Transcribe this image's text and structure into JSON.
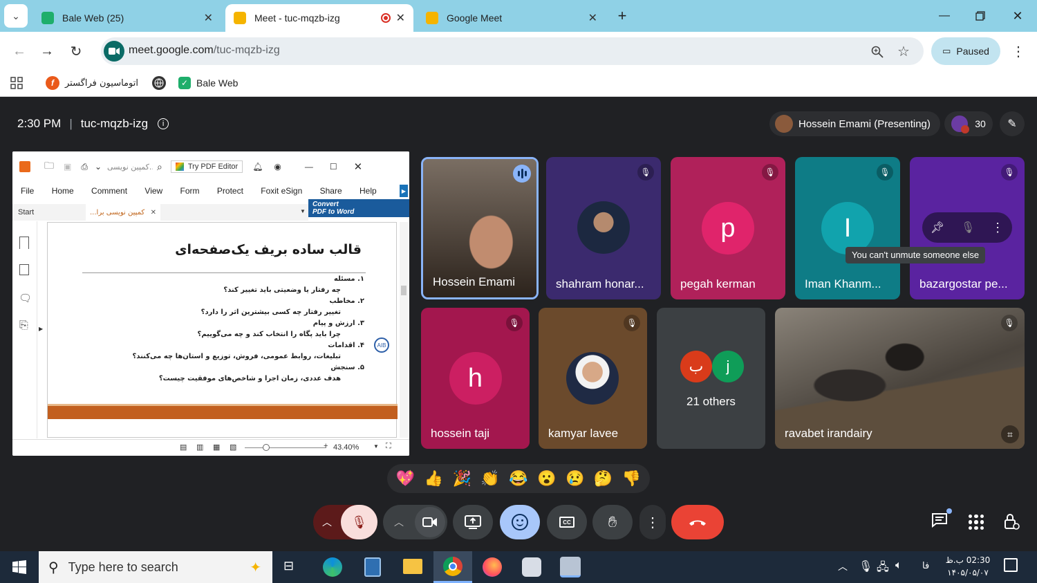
{
  "browser": {
    "tabs": [
      {
        "title": "Bale Web (25)",
        "favicon": "bale-icon",
        "color": "#1eae6b"
      },
      {
        "title": "Meet - tuc-mqzb-izg",
        "favicon": "meet-icon",
        "color": "#f5b400",
        "recording": true
      },
      {
        "title": "Google Meet",
        "favicon": "meet-icon",
        "color": "#f5b400"
      }
    ],
    "url_host": "meet.google.com",
    "url_path": "/tuc-mqzb-izg",
    "profile_status": "Paused",
    "bookmarks": [
      {
        "label": "اتوماسیون فراگستر",
        "icon": "faragostar-icon"
      },
      {
        "label": "",
        "icon": "globe-icon"
      },
      {
        "label": "Bale Web",
        "icon": "bale-icon"
      }
    ]
  },
  "meeting": {
    "time": "2:30 PM",
    "code": "tuc-mqzb-izg",
    "presenter_chip": "Hossein Emami (Presenting)",
    "participant_count": "30",
    "participants": [
      {
        "name": "Hossein Emami",
        "kind": "video",
        "speaking": true
      },
      {
        "name": "shahram honar...",
        "kind": "photo",
        "bg": "#3b2a6e",
        "muted": true
      },
      {
        "name": "pegah kerman",
        "kind": "letter",
        "letter": "p",
        "bg": "#b0215a",
        "avatar": "#e0246b",
        "muted": true
      },
      {
        "name": "Iman Khanm...",
        "kind": "letter",
        "letter": "I",
        "bg": "#0e7c86",
        "avatar": "#11a3ad",
        "muted": true
      },
      {
        "name": "bazargostar pe...",
        "kind": "letter",
        "letter": "",
        "bg": "#5a23a0",
        "muted": true
      },
      {
        "name": "hossein taji",
        "kind": "letter",
        "letter": "h",
        "bg": "#a3174e",
        "avatar": "#cc1f62",
        "muted": true
      },
      {
        "name": "kamyar lavee",
        "kind": "photo",
        "bg": "#6b4a2c",
        "muted": true
      },
      {
        "name": "21 others",
        "kind": "others",
        "bg": "#3c4043",
        "avatars": [
          {
            "letter": "ب",
            "color": "#d93b1a"
          },
          {
            "letter": "j",
            "color": "#0f9d58"
          }
        ]
      },
      {
        "name": "ravabet irandairy",
        "kind": "video",
        "muted": true
      }
    ],
    "tooltip": "You can't unmute someone else",
    "reactions": [
      "💖",
      "👍",
      "🎉",
      "👏",
      "😂",
      "😮",
      "😢",
      "🤔",
      "👎"
    ]
  },
  "pdf": {
    "search_placeholder": "کمپین نویسی...",
    "try_editor": "Try PDF Editor",
    "menu": [
      "File",
      "Home",
      "Comment",
      "View",
      "Form",
      "Protect",
      "Foxit eSign",
      "Share",
      "Help"
    ],
    "convert_line1": "Convert",
    "convert_line2": "PDF to Word",
    "tab_start": "Start",
    "tab_doc": "...کمپین نویسی برا",
    "doc_title": "قالب ساده بریف یک‌صفحه‌ای",
    "doc_lines": [
      "۱. مسئله",
      "چه رفتار یا وضعیتی باید تغییر کند؟",
      "۲. مخاطب",
      "تغییر رفتار چه کسی بیشترین اثر را دارد؟",
      "۳. ارزش و پیام",
      "چرا باید پگاه را انتخاب کند و چه می‌گوییم؟",
      "۴. اقدامات",
      "تبلیغات، روابط عمومی، فروش، توزیع و استان‌ها چه می‌کنند؟",
      "۵. سنجش",
      "هدف عددی، زمان اجرا و شاخص‌های موفقیت چیست؟"
    ],
    "zoom": "43.40%"
  },
  "taskbar": {
    "search_placeholder": "Type here to search",
    "lang": "فا",
    "time": "02:30 ب.ظ",
    "date": "۱۴۰۵/۰۵/۰۷"
  },
  "colors": {
    "end_call": "#ea4335",
    "mic_off": "#f9dedc",
    "emoji_active": "#a8c7fa"
  }
}
